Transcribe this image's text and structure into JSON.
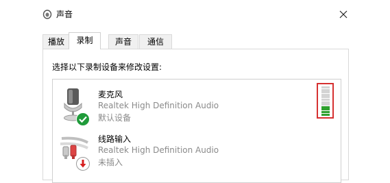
{
  "window": {
    "title": "声音",
    "close_label": "✕"
  },
  "tabs": [
    {
      "label": "播放",
      "active": false
    },
    {
      "label": "录制",
      "active": true
    },
    {
      "label": "声音",
      "active": false
    },
    {
      "label": "通信",
      "active": false
    }
  ],
  "instruction": "选择以下录制设备来修改设置:",
  "devices": [
    {
      "name": "麦克风",
      "driver": "Realtek High Definition Audio",
      "status": "默认设备",
      "icon": "microphone-icon",
      "badge": "default-check-icon"
    },
    {
      "name": "线路输入",
      "driver": "Realtek High Definition Audio",
      "status": "未插入",
      "icon": "line-in-cable-icon",
      "badge": "unplugged-arrow-icon"
    }
  ],
  "level_meter": {
    "total_segments": 12,
    "lit_segments": 4,
    "lit_color": "#2ea02e",
    "unlit_color": "#d4d4d4",
    "highlight_color": "#d63030"
  }
}
